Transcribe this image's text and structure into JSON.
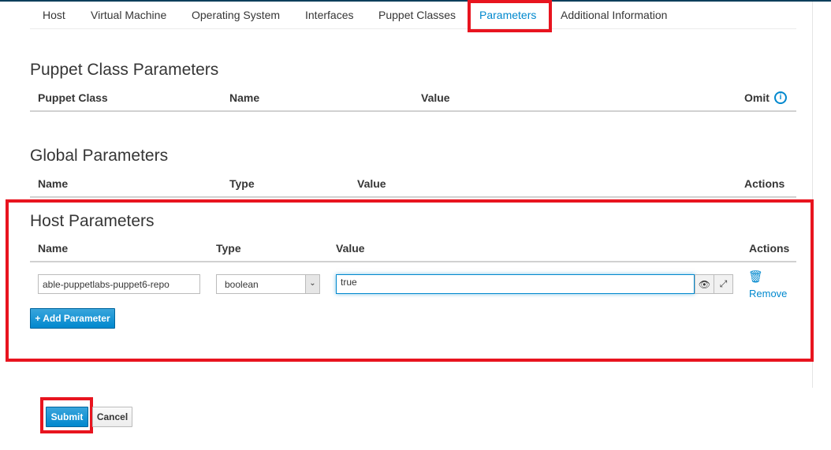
{
  "tabs": [
    "Host",
    "Virtual Machine",
    "Operating System",
    "Interfaces",
    "Puppet Classes",
    "Parameters",
    "Additional Information"
  ],
  "active_tab": "Parameters",
  "puppet_class_parameters": {
    "title": "Puppet Class Parameters",
    "columns": [
      "Puppet Class",
      "Name",
      "Value",
      "Omit"
    ]
  },
  "global_parameters": {
    "title": "Global Parameters",
    "columns": [
      "Name",
      "Type",
      "Value",
      "Actions"
    ]
  },
  "host_parameters": {
    "title": "Host Parameters",
    "columns": [
      "Name",
      "Type",
      "Value",
      "Actions"
    ],
    "rows": [
      {
        "name": "able-puppetlabs-puppet6-repo",
        "type": "boolean",
        "value": "true",
        "remove_label": "Remove"
      }
    ],
    "add_label": "+ Add Parameter"
  },
  "form": {
    "submit_label": "Submit",
    "cancel_label": "Cancel"
  },
  "colors": {
    "accent": "#0088ce",
    "highlight": "#e8141f"
  }
}
